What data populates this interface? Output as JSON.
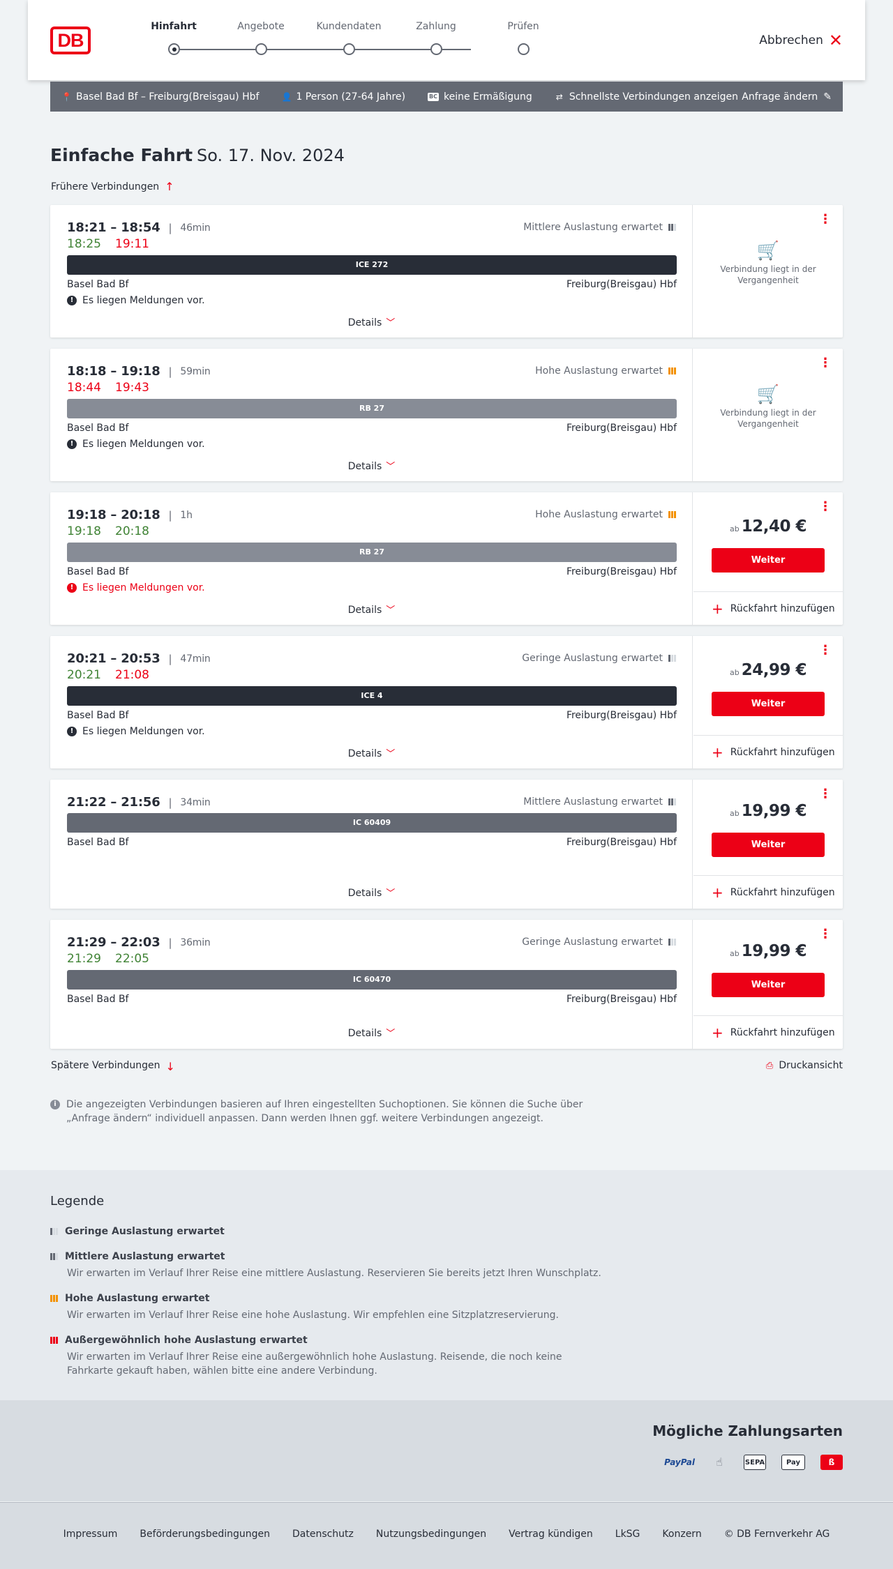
{
  "header": {
    "logo": "DB",
    "steps": [
      "Hinfahrt",
      "Angebote",
      "Kundendaten",
      "Zahlung",
      "Prüfen"
    ],
    "active_step": "Hinfahrt",
    "cancel_label": "Abbrechen"
  },
  "searchbar": {
    "route": "Basel Bad Bf – Freiburg(Breisgau) Hbf",
    "passengers": "1 Person (27-64 Jahre)",
    "discount_badge": "BC",
    "discount": "keine Ermäßigung",
    "fastest": "Schnellste Verbindungen anzeigen",
    "edit": "Anfrage ändern"
  },
  "title": {
    "main": "Einfache Fahrt",
    "date": "So. 17. Nov. 2024"
  },
  "earlier_label": "Frühere Verbindungen",
  "later_label": "Spätere Verbindungen",
  "print_label": "Druckansicht",
  "details_label": "Details",
  "weiter_label": "Weiter",
  "return_label": "Rückfahrt hinzufügen",
  "price_prefix": "ab",
  "past_label": "Verbindung liegt in der Vergangenheit",
  "connections": [
    {
      "times": "18:21 – 18:54",
      "duration": "46min",
      "rt_dep": "18:25",
      "rt_arr": "19:11",
      "rt_dep_color": "green",
      "rt_arr_color": "red",
      "occupancy": "Mittlere Auslastung erwartet",
      "train": "ICE 272",
      "from": "Basel Bad Bf",
      "to": "Freiburg(Breisgau) Hbf",
      "notice": "Es liegen Meldungen vor.",
      "notice_alert": false,
      "past": true
    },
    {
      "times": "18:18 – 19:18",
      "duration": "59min",
      "rt_dep": "18:44",
      "rt_arr": "19:43",
      "rt_dep_color": "red",
      "rt_arr_color": "red",
      "occupancy": "Hohe Auslastung erwartet",
      "train": "RB 27",
      "from": "Basel Bad Bf",
      "to": "Freiburg(Breisgau) Hbf",
      "notice": "Es liegen Meldungen vor.",
      "notice_alert": false,
      "past": true
    },
    {
      "times": "19:18 – 20:18",
      "duration": "1h",
      "rt_dep": "19:18",
      "rt_arr": "20:18",
      "rt_dep_color": "green",
      "rt_arr_color": "green",
      "occupancy": "Hohe Auslastung erwartet",
      "train": "RB 27",
      "from": "Basel Bad Bf",
      "to": "Freiburg(Breisgau) Hbf",
      "notice": "Es liegen Meldungen vor.",
      "notice_alert": true,
      "price": "12,40 €"
    },
    {
      "times": "20:21 – 20:53",
      "duration": "47min",
      "rt_dep": "20:21",
      "rt_arr": "21:08",
      "rt_dep_color": "green",
      "rt_arr_color": "red",
      "occupancy": "Geringe Auslastung erwartet",
      "train": "ICE 4",
      "from": "Basel Bad Bf",
      "to": "Freiburg(Breisgau) Hbf",
      "notice": "Es liegen Meldungen vor.",
      "notice_alert": false,
      "price": "24,99 €"
    },
    {
      "times": "21:22 – 21:56",
      "duration": "34min",
      "occupancy": "Mittlere Auslastung erwartet",
      "train": "IC 60409",
      "from": "Basel Bad Bf",
      "to": "Freiburg(Breisgau) Hbf",
      "price": "19,99 €"
    },
    {
      "times": "21:29 – 22:03",
      "duration": "36min",
      "rt_dep": "21:29",
      "rt_arr": "22:05",
      "rt_dep_color": "green",
      "rt_arr_color": "green",
      "occupancy": "Geringe Auslastung erwartet",
      "train": "IC 60470",
      "from": "Basel Bad Bf",
      "to": "Freiburg(Breisgau) Hbf",
      "price": "19,99 €"
    }
  ],
  "info_text": "Die angezeigten Verbindungen basieren auf Ihren eingestellten Suchoptionen. Sie können die Suche über „Anfrage ändern“ individuell anpassen. Dann werden Ihnen ggf. weitere Verbindungen angezeigt.",
  "legend": {
    "title": "Legende",
    "items": [
      {
        "title": "Geringe Auslastung erwartet",
        "desc": ""
      },
      {
        "title": "Mittlere Auslastung erwartet",
        "desc": "Wir erwarten im Verlauf Ihrer Reise eine mittlere Auslastung. Reservieren Sie bereits jetzt Ihren Wunschplatz."
      },
      {
        "title": "Hohe Auslastung erwartet",
        "desc": "Wir erwarten im Verlauf Ihrer Reise eine hohe Auslastung. Wir empfehlen eine Sitzplatzreservierung."
      },
      {
        "title": "Außergewöhnlich hohe Auslastung erwartet",
        "desc": "Wir erwarten im Verlauf Ihrer Reise eine außergewöhnlich hohe Auslastung. Reisende, die noch keine Fahrkarte gekauft haben, wählen bitte eine andere Verbindung."
      }
    ]
  },
  "payment": {
    "title": "Mögliche Zahlungsarten",
    "methods": [
      "PayPal",
      "SEPA",
      "Apple Pay"
    ]
  },
  "footer": {
    "links": [
      "Impressum",
      "Beförderungsbedingungen",
      "Datenschutz",
      "Nutzungsbedingungen",
      "Vertrag kündigen",
      "LkSG",
      "Konzern",
      "© DB Fernverkehr AG"
    ]
  },
  "colors": {
    "accent": "#ec0016",
    "on_time": "#408335",
    "dark": "#282d37",
    "bar": "#646973"
  }
}
